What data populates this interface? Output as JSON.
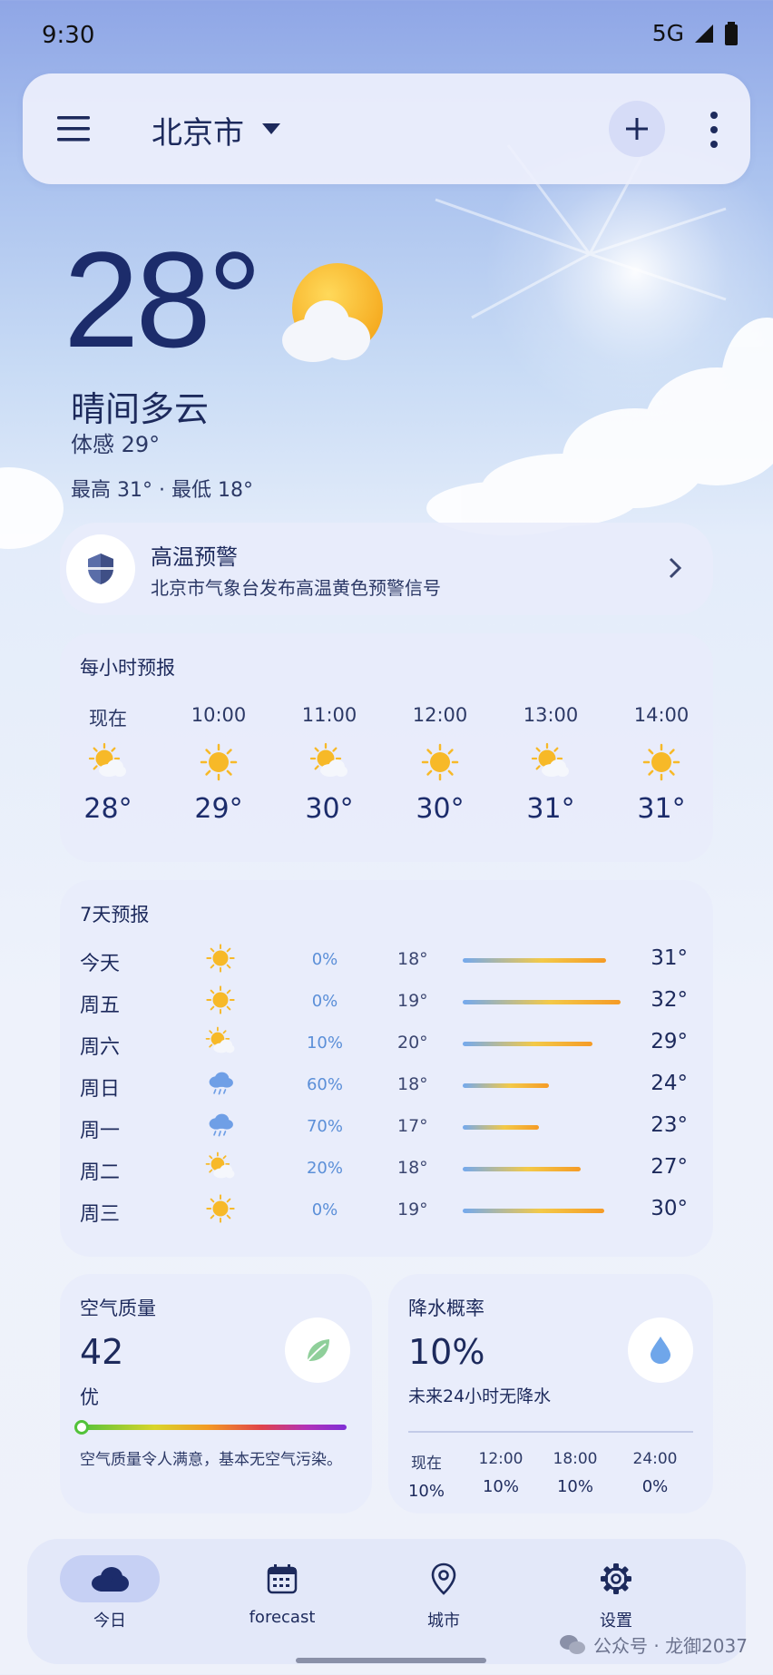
{
  "status_bar": {
    "time": "9:30",
    "network": "5G"
  },
  "app_bar": {
    "city": "北京市"
  },
  "current": {
    "temperature": "28°",
    "condition": "晴间多云",
    "feels_like": "体感 29°",
    "high_low": "最高 31° · 最低 18°"
  },
  "alert": {
    "title": "高温预警",
    "message": "北京市气象台发布高温黄色预警信号"
  },
  "hourly": {
    "title": "每小时预报",
    "items": [
      {
        "time": "现在",
        "icon": "partly-cloudy-icon",
        "temp": "28°"
      },
      {
        "time": "10:00",
        "icon": "sun-icon",
        "temp": "29°"
      },
      {
        "time": "11:00",
        "icon": "partly-cloudy-icon",
        "temp": "30°"
      },
      {
        "time": "12:00",
        "icon": "sun-icon",
        "temp": "30°"
      },
      {
        "time": "13:00",
        "icon": "partly-cloudy-icon",
        "temp": "31°"
      },
      {
        "time": "14:00",
        "icon": "sun-icon",
        "temp": "31°"
      }
    ]
  },
  "daily": {
    "title": "7天预报",
    "items": [
      {
        "day": "今天",
        "icon": "sun-icon",
        "precip": "0%",
        "low": "18°",
        "high": "31°",
        "bar_fraction": 0.72
      },
      {
        "day": "周五",
        "icon": "sun-icon",
        "precip": "0%",
        "low": "19°",
        "high": "32°",
        "bar_fraction": 0.79
      },
      {
        "day": "周六",
        "icon": "partly-cloudy-icon",
        "precip": "10%",
        "low": "20°",
        "high": "29°",
        "bar_fraction": 0.65
      },
      {
        "day": "周日",
        "icon": "rain-icon",
        "precip": "60%",
        "low": "18°",
        "high": "24°",
        "bar_fraction": 0.43
      },
      {
        "day": "周一",
        "icon": "rain-icon",
        "precip": "70%",
        "low": "17°",
        "high": "23°",
        "bar_fraction": 0.38
      },
      {
        "day": "周二",
        "icon": "partly-cloudy-icon",
        "precip": "20%",
        "low": "18°",
        "high": "27°",
        "bar_fraction": 0.59
      },
      {
        "day": "周三",
        "icon": "sun-icon",
        "precip": "0%",
        "low": "19°",
        "high": "30°",
        "bar_fraction": 0.71
      }
    ]
  },
  "air_quality": {
    "title": "空气质量",
    "value": "42",
    "level": "优",
    "description": "空气质量令人满意，基本无空气污染。"
  },
  "precipitation": {
    "title": "降水概率",
    "value": "10%",
    "summary": "未来24小时无降水",
    "points": [
      {
        "time": "现在",
        "value": "10%"
      },
      {
        "time": "12:00",
        "value": "10%"
      },
      {
        "time": "18:00",
        "value": "10%"
      },
      {
        "time": "24:00",
        "value": "0%"
      }
    ]
  },
  "bottom_nav": [
    {
      "label": "今日",
      "icon": "cloud-icon",
      "active": true
    },
    {
      "label": "forecast",
      "icon": "calendar-icon",
      "active": false
    },
    {
      "label": "城市",
      "icon": "location-pin-icon",
      "active": false
    },
    {
      "label": "设置",
      "icon": "gear-icon",
      "active": false
    }
  ],
  "watermark": "公众号 · 龙御2037",
  "colors": {
    "accent": "#1c2c6b",
    "sun": "#f7b928",
    "precip": "#5b8fd8"
  }
}
